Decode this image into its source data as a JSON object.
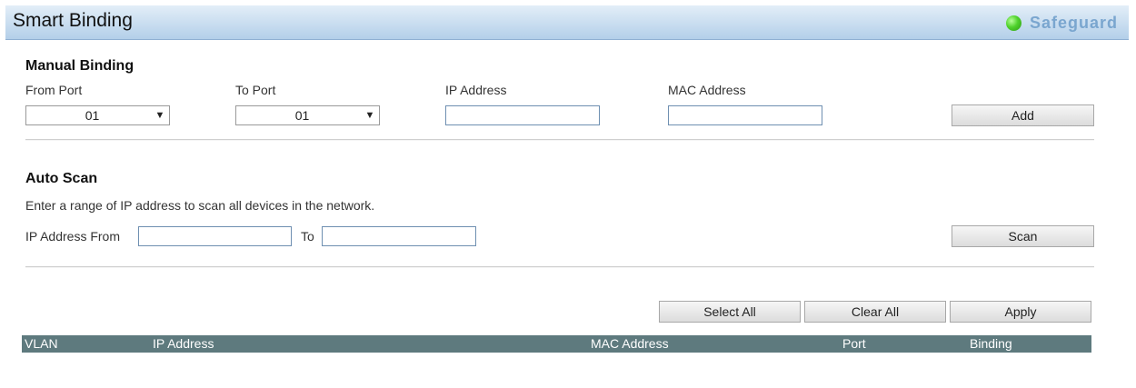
{
  "header": {
    "title": "Smart Binding",
    "status_label": "Safeguard",
    "status_color": "#4fd22c"
  },
  "manual_binding": {
    "title": "Manual Binding",
    "from_port_label": "From Port",
    "to_port_label": "To Port",
    "ip_label": "IP Address",
    "mac_label": "MAC Address",
    "from_port_value": "01",
    "to_port_value": "01",
    "ip_value": "",
    "mac_value": "",
    "add_label": "Add"
  },
  "auto_scan": {
    "title": "Auto Scan",
    "description": "Enter a range of IP address to scan all devices in the network.",
    "from_label": "IP Address From",
    "to_label": "To",
    "from_value": "",
    "to_value": "",
    "scan_label": "Scan"
  },
  "actions": {
    "select_all": "Select All",
    "clear_all": "Clear All",
    "apply": "Apply"
  },
  "table": {
    "columns": [
      "VLAN",
      "IP Address",
      "MAC Address",
      "Port",
      "Binding"
    ],
    "header_color": "#5e7a7e"
  }
}
